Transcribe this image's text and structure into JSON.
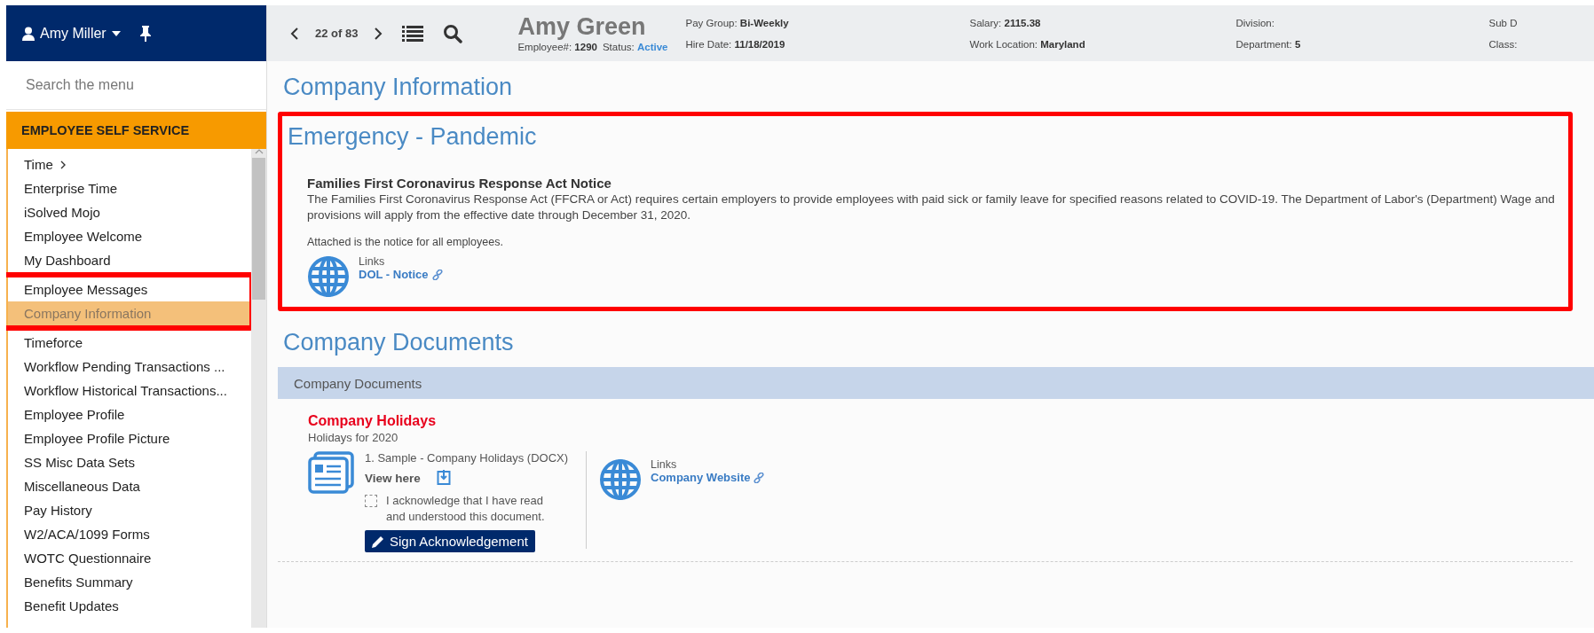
{
  "user_menu": {
    "name": "Amy Miller"
  },
  "sidebar": {
    "search_placeholder": "Search the menu",
    "section": "EMPLOYEE SELF SERVICE",
    "items": [
      {
        "label": "Time",
        "has_submenu": true,
        "selected": false,
        "annotated": false
      },
      {
        "label": "Enterprise Time",
        "has_submenu": false,
        "selected": false,
        "annotated": false
      },
      {
        "label": "iSolved Mojo",
        "has_submenu": false,
        "selected": false,
        "annotated": false
      },
      {
        "label": "Employee Welcome",
        "has_submenu": false,
        "selected": false,
        "annotated": false
      },
      {
        "label": "My Dashboard",
        "has_submenu": false,
        "selected": false,
        "annotated": false
      },
      {
        "label": "Employee Messages",
        "has_submenu": false,
        "selected": false,
        "annotated": true
      },
      {
        "label": "Company Information",
        "has_submenu": false,
        "selected": true,
        "annotated": true
      },
      {
        "label": "Timeforce",
        "has_submenu": false,
        "selected": false,
        "annotated": false
      },
      {
        "label": "Workflow Pending Transactions ...",
        "has_submenu": false,
        "selected": false,
        "annotated": false
      },
      {
        "label": "Workflow Historical Transactions...",
        "has_submenu": false,
        "selected": false,
        "annotated": false
      },
      {
        "label": "Employee Profile",
        "has_submenu": false,
        "selected": false,
        "annotated": false
      },
      {
        "label": "Employee Profile Picture",
        "has_submenu": false,
        "selected": false,
        "annotated": false
      },
      {
        "label": "SS Misc Data Sets",
        "has_submenu": false,
        "selected": false,
        "annotated": false
      },
      {
        "label": "Miscellaneous Data",
        "has_submenu": false,
        "selected": false,
        "annotated": false
      },
      {
        "label": "Pay History",
        "has_submenu": false,
        "selected": false,
        "annotated": false
      },
      {
        "label": "W2/ACA/1099 Forms",
        "has_submenu": false,
        "selected": false,
        "annotated": false
      },
      {
        "label": "WOTC Questionnaire",
        "has_submenu": false,
        "selected": false,
        "annotated": false
      },
      {
        "label": "Benefits Summary",
        "has_submenu": false,
        "selected": false,
        "annotated": false
      },
      {
        "label": "Benefit Updates",
        "has_submenu": false,
        "selected": false,
        "annotated": false
      }
    ]
  },
  "employee_header": {
    "position": "22 of 83",
    "name": "Amy Green",
    "number_label": "Employee#:",
    "number": "1290",
    "status_label": "Status:",
    "status": "Active",
    "field_columns": [
      [
        {
          "label": "Pay Group:",
          "value": "Bi-Weekly"
        },
        {
          "label": "Hire Date:",
          "value": "11/18/2019"
        }
      ],
      [
        {
          "label": "Salary:",
          "value": "2115.38"
        },
        {
          "label": "Work Location:",
          "value": "Maryland"
        }
      ],
      [
        {
          "label": "Division:"
        },
        {
          "label": "Department:",
          "value": "5"
        }
      ],
      [
        {
          "label": "Sub D"
        },
        {
          "label": "Class:"
        }
      ]
    ]
  },
  "page_title": "Company Information",
  "sections": [
    {
      "kind": "notice",
      "title": "Emergency - Pandemic",
      "annotated": true,
      "notice_title": "Families First Coronavirus Response Act Notice",
      "body": "The Families First Coronavirus Response Act (FFCRA or Act) requires certain employers to provide employees with paid sick or family leave for specified reasons related to COVID-19. The Department of Labor's (Department) Wage and provisions will apply from the effective date through December 31, 2020.",
      "note": "Attached is the notice for all employees.",
      "links_label": "Links",
      "links": [
        "DOL - Notice"
      ]
    },
    {
      "kind": "documents",
      "title": "Company Documents",
      "annotated": false,
      "bar_title": "Company Documents",
      "document": {
        "title": "Company Holidays",
        "subtitle": "Holidays for 2020",
        "file": "1. Sample - Company Holidays (DOCX)",
        "view": "View here",
        "ack_text": "I acknowledge that I have read and understood this document.",
        "acknowledged": false,
        "button": "Sign Acknowledgement",
        "links_label": "Links",
        "links": [
          "Company Website"
        ]
      }
    }
  ]
}
